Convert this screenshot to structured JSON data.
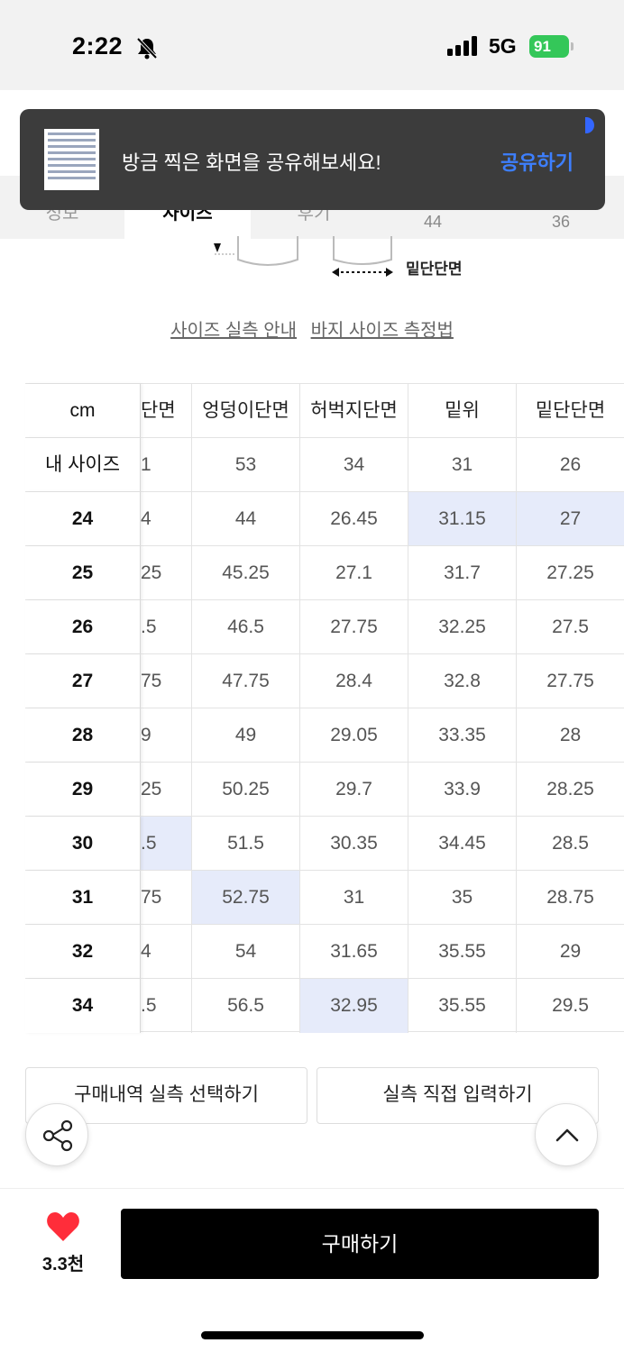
{
  "status_bar": {
    "time": "2:22",
    "network": "5G",
    "battery": "91"
  },
  "toast": {
    "message": "방금 찍은 화면을 공유해보세요!",
    "action": "공유하기"
  },
  "tabs": {
    "items": [
      "정보",
      "사이즈",
      "후기"
    ],
    "right_values": [
      "44",
      "36"
    ]
  },
  "diagram": {
    "hem_label": "밑단단면"
  },
  "guide_links": {
    "size_guide": "사이즈 실측 안내",
    "measure_guide": "바지 사이즈 측정법"
  },
  "size_table": {
    "unit": "cm",
    "columns": [
      "단면",
      "엉덩이단면",
      "허벅지단면",
      "밑위",
      "밑단단면"
    ],
    "my_size": {
      "label": "내 사이즈",
      "values": [
        "1",
        "53",
        "34",
        "31",
        "26"
      ]
    },
    "rows": [
      {
        "size": "24",
        "values": [
          "4",
          "44",
          "26.45",
          "31.15",
          "27"
        ]
      },
      {
        "size": "25",
        "values": [
          "25",
          "45.25",
          "27.1",
          "31.7",
          "27.25"
        ]
      },
      {
        "size": "26",
        "values": [
          ".5",
          "46.5",
          "27.75",
          "32.25",
          "27.5"
        ]
      },
      {
        "size": "27",
        "values": [
          "75",
          "47.75",
          "28.4",
          "32.8",
          "27.75"
        ]
      },
      {
        "size": "28",
        "values": [
          "9",
          "49",
          "29.05",
          "33.35",
          "28"
        ]
      },
      {
        "size": "29",
        "values": [
          "25",
          "50.25",
          "29.7",
          "33.9",
          "28.25"
        ]
      },
      {
        "size": "30",
        "values": [
          ".5",
          "51.5",
          "30.35",
          "34.45",
          "28.5"
        ]
      },
      {
        "size": "31",
        "values": [
          "75",
          "52.75",
          "31",
          "35",
          "28.75"
        ]
      },
      {
        "size": "32",
        "values": [
          "4",
          "54",
          "31.65",
          "35.55",
          "29"
        ]
      },
      {
        "size": "34",
        "values": [
          ".5",
          "56.5",
          "32.95",
          "35.55",
          "29.5"
        ]
      }
    ],
    "highlight_color": "#e6ebfa"
  },
  "actions": {
    "purchase_history": "구매내역 실측 선택하기",
    "direct_input": "실측 직접 입력하기"
  },
  "bottom_bar": {
    "likes": "3.3천",
    "buy": "구매하기"
  },
  "icons": [
    "bell-muted-icon",
    "signal-icon",
    "battery-icon",
    "share-icon",
    "chevron-up-icon",
    "heart-icon"
  ],
  "colors": {
    "accent": "#3d7fff",
    "heart": "#ff2d3a",
    "buy_button": "#000000",
    "battery": "#34c759"
  }
}
